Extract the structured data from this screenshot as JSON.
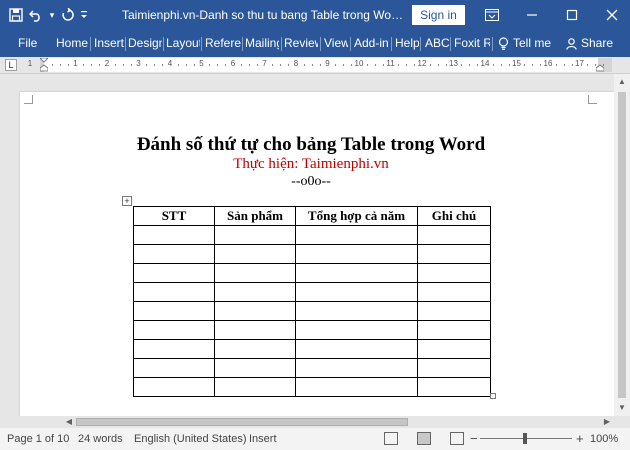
{
  "titlebar": {
    "title": "Taimienphi.vn-Danh so thu tu bang Table trong Word.docx - Word",
    "signin_label": "Sign in",
    "qat_icons": [
      "save-icon",
      "undo-icon",
      "undo-dropdown-icon",
      "redo-icon",
      "customize-icon"
    ],
    "win_buttons": [
      "ribbon-display-icon",
      "minimize-icon",
      "maximize-icon",
      "close-icon"
    ]
  },
  "ribbon": {
    "tabs": [
      "File",
      "Home",
      "Insert",
      "Design",
      "Layout",
      "Referer",
      "Mailing",
      "Review",
      "View",
      "Add-in",
      "Help",
      "ABC",
      "Foxit Re"
    ],
    "tell_me": "Tell me",
    "share": "Share"
  },
  "ruler": {
    "numbers": [
      "1",
      "1",
      "2",
      "3",
      "4",
      "5",
      "6",
      "7",
      "8",
      "9",
      "10",
      "11",
      "12",
      "13",
      "14",
      "15",
      "16",
      "17"
    ],
    "tab_stop_label": "L"
  },
  "document": {
    "heading": "Đánh số thứ tự cho bảng Table trong Word",
    "subtitle": "Thực hiện: Taimienphi.vn",
    "separator": "--o0o--",
    "table": {
      "headers": [
        "STT",
        "Sản phẩm",
        "Tổng hợp cả năm",
        "Ghi chú"
      ],
      "rows": [
        [
          "",
          "",
          "",
          ""
        ],
        [
          "",
          "",
          "",
          ""
        ],
        [
          "",
          "",
          "",
          ""
        ],
        [
          "",
          "",
          "",
          ""
        ],
        [
          "",
          "",
          "",
          ""
        ],
        [
          "",
          "",
          "",
          ""
        ],
        [
          "",
          "",
          "",
          ""
        ],
        [
          "",
          "",
          "",
          ""
        ],
        [
          "",
          "",
          "",
          ""
        ]
      ]
    }
  },
  "statusbar": {
    "page": "Page 1 of 10",
    "words": "24 words",
    "language": "English (United States)",
    "mode": "Insert",
    "zoom": "100%",
    "zoom_minus": "−",
    "zoom_plus": "+"
  }
}
